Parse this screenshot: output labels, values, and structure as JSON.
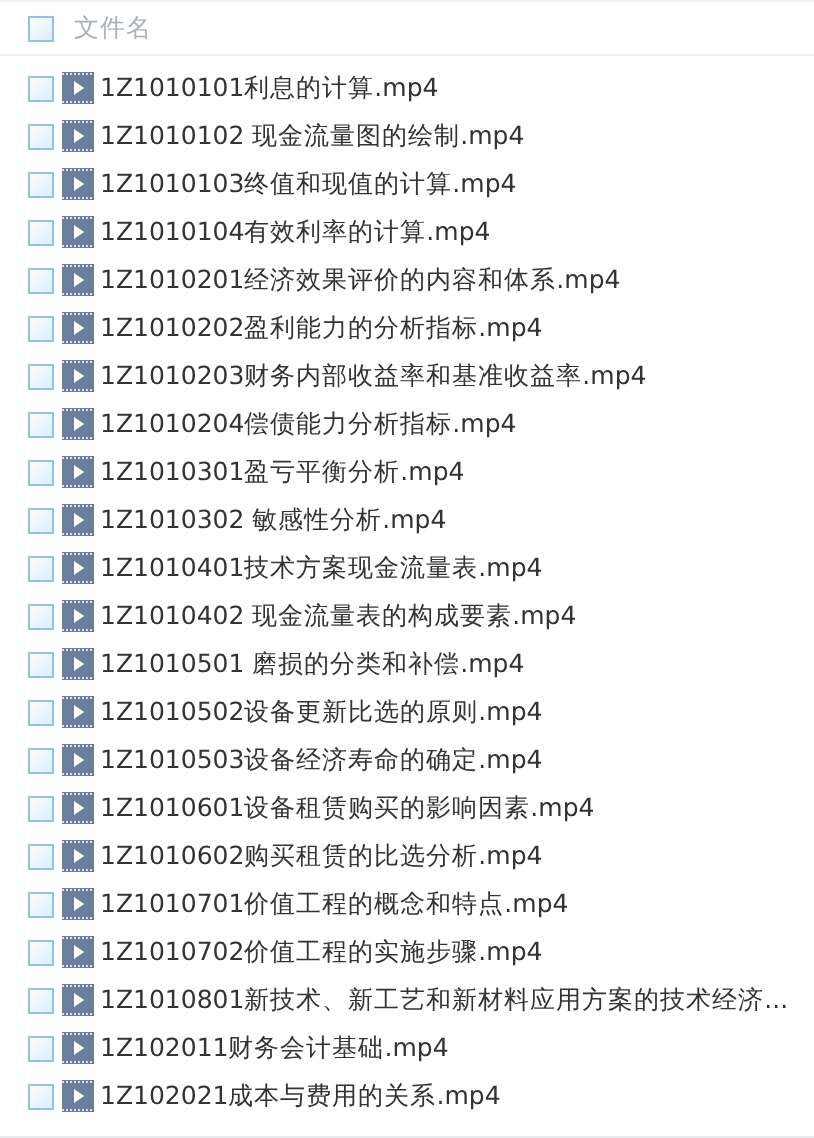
{
  "header": {
    "label": "文件名",
    "checked": false
  },
  "files": [
    {
      "name": "1Z1010101利息的计算.mp4",
      "checked": false
    },
    {
      "name": "1Z1010102 现金流量图的绘制.mp4",
      "checked": false
    },
    {
      "name": "1Z1010103终值和现值的计算.mp4",
      "checked": false
    },
    {
      "name": "1Z1010104有效利率的计算.mp4",
      "checked": false
    },
    {
      "name": "1Z1010201经济效果评价的内容和体系.mp4",
      "checked": false
    },
    {
      "name": "1Z1010202盈利能力的分析指标.mp4",
      "checked": false
    },
    {
      "name": "1Z1010203财务内部收益率和基准收益率.mp4",
      "checked": false
    },
    {
      "name": "1Z1010204偿债能力分析指标.mp4",
      "checked": false
    },
    {
      "name": "1Z1010301盈亏平衡分析.mp4",
      "checked": false
    },
    {
      "name": "1Z1010302 敏感性分析.mp4",
      "checked": false
    },
    {
      "name": "1Z1010401技术方案现金流量表.mp4",
      "checked": false
    },
    {
      "name": "1Z1010402 现金流量表的构成要素.mp4",
      "checked": false
    },
    {
      "name": "1Z1010501 磨损的分类和补偿.mp4",
      "checked": false
    },
    {
      "name": "1Z1010502设备更新比选的原则.mp4",
      "checked": false
    },
    {
      "name": "1Z1010503设备经济寿命的确定.mp4",
      "checked": false
    },
    {
      "name": "1Z1010601设备租赁购买的影响因素.mp4",
      "checked": false
    },
    {
      "name": "1Z1010602购买租赁的比选分析.mp4",
      "checked": false
    },
    {
      "name": "1Z1010701价值工程的概念和特点.mp4",
      "checked": false
    },
    {
      "name": "1Z1010702价值工程的实施步骤.mp4",
      "checked": false
    },
    {
      "name": "1Z1010801新技术、新工艺和新材料应用方案的技术经济...",
      "checked": false
    },
    {
      "name": "1Z102011财务会计基础.mp4",
      "checked": false
    },
    {
      "name": "1Z102021成本与费用的关系.mp4",
      "checked": false
    }
  ]
}
